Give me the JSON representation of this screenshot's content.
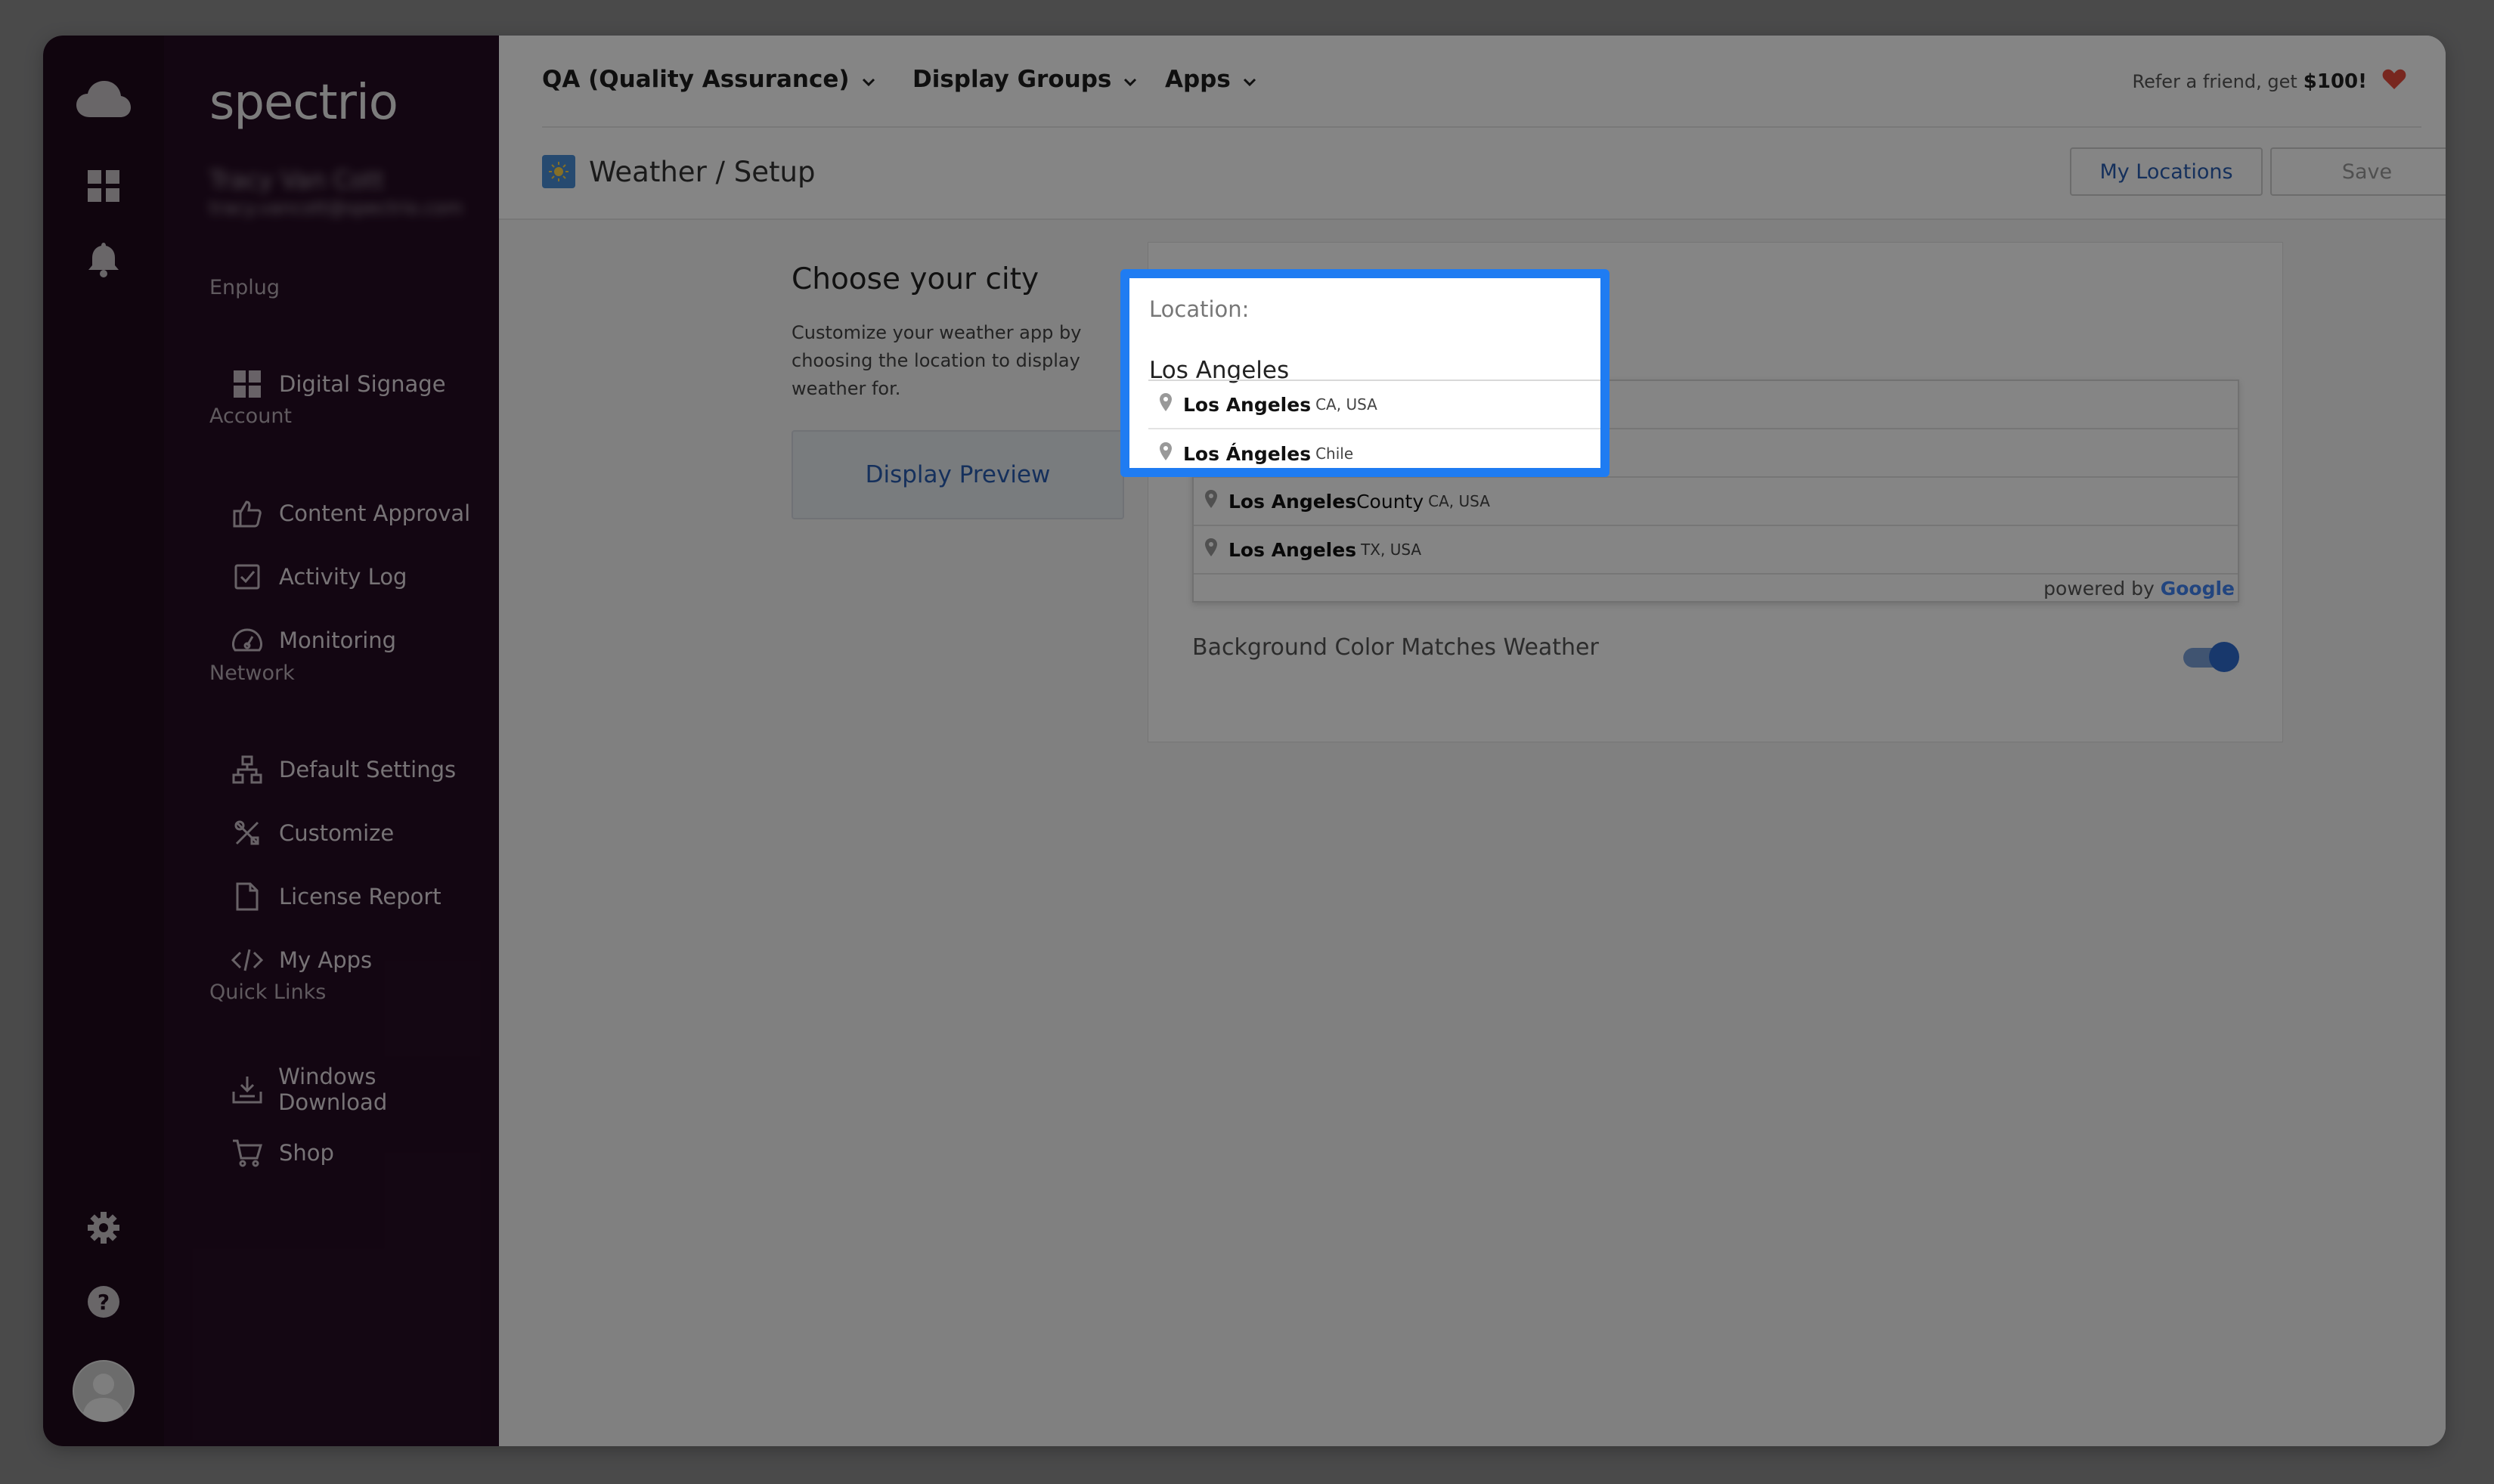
{
  "app": {
    "logo": "spectrio"
  },
  "user": {
    "name": "Tracy Van Cott",
    "email": "tracy.vancott@spectrio.com"
  },
  "sidebar": {
    "sections": [
      {
        "label": "Enplug",
        "items": [
          {
            "label": "Digital Signage",
            "icon": "grid-icon"
          }
        ]
      },
      {
        "label": "Account",
        "items": [
          {
            "label": "Content Approval",
            "icon": "thumbs-up-icon"
          },
          {
            "label": "Activity Log",
            "icon": "checkbox-icon"
          },
          {
            "label": "Monitoring",
            "icon": "gauge-icon"
          }
        ]
      },
      {
        "label": "Network",
        "items": [
          {
            "label": "Default Settings",
            "icon": "network-icon"
          },
          {
            "label": "Customize",
            "icon": "tools-icon"
          },
          {
            "label": "License Report",
            "icon": "document-icon"
          },
          {
            "label": "My Apps",
            "icon": "code-icon"
          }
        ]
      },
      {
        "label": "Quick Links",
        "items": [
          {
            "label": "Windows Download",
            "icon": "download-icon"
          },
          {
            "label": "Shop",
            "icon": "cart-icon"
          }
        ]
      }
    ]
  },
  "topbar": {
    "nav": [
      "QA (Quality Assurance)",
      "Display Groups",
      "Apps"
    ],
    "refer_text": "Refer a friend, get",
    "refer_amount": "$100!"
  },
  "page": {
    "breadcrumb": "Weather / Setup",
    "my_locations_label": "My Locations",
    "save_label": "Save"
  },
  "content": {
    "title": "Choose your city",
    "description": "Customize your weather app by choosing the location to display weather for.",
    "preview_label": "Display Preview",
    "location_label": "Location:",
    "location_value": "Los Angeles",
    "toggle_label": "Background Color Matches Weather",
    "toggle_on": true,
    "suggestions": [
      {
        "main": "Los Angeles",
        "secondary": "CA, USA"
      },
      {
        "main": "Los Ángeles",
        "secondary": "Chile"
      },
      {
        "main": "Los Angeles",
        "extra": " County",
        "secondary": "CA, USA"
      },
      {
        "main": "Los Angeles",
        "secondary": "TX, USA"
      }
    ],
    "powered_by": "powered by",
    "google": "Google"
  },
  "colors": {
    "rail": "#1f0b1c",
    "sidebar": "#260d24",
    "accent": "#1f7cf2",
    "link": "#2a5db0",
    "heart": "#e74c3c"
  }
}
